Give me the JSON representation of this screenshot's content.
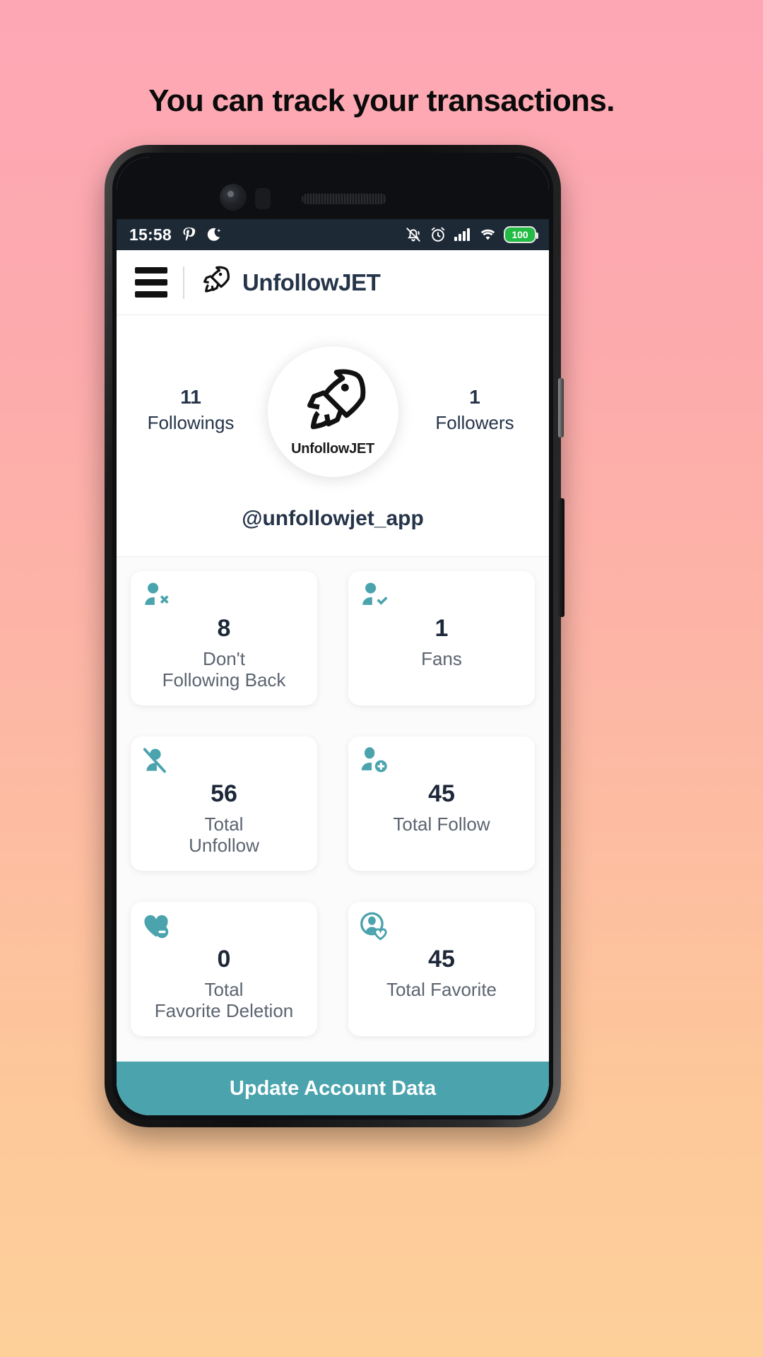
{
  "promo": {
    "headline": "You can track your transactions."
  },
  "statusbar": {
    "time": "15:58",
    "icons_left": [
      "pinterest-icon",
      "moon-star-icon"
    ],
    "icons_right": [
      "notifications-off-icon",
      "alarm-icon",
      "cellular-signal-icon",
      "wifi-icon"
    ],
    "battery_level": "100"
  },
  "appbar": {
    "menu_icon": "hamburger-menu-icon",
    "logo_icon": "rocket-icon",
    "brand": "UnfollowJET"
  },
  "profile": {
    "followings_count": "11",
    "followings_label": "Followings",
    "followers_count": "1",
    "followers_label": "Followers",
    "avatar_name": "UnfollowJET",
    "handle": "@unfollowjet_app"
  },
  "colors": {
    "accent_teal": "#4aa3ad",
    "navy": "#253449",
    "label_gray": "#5c6470",
    "status_bg": "#1e2936",
    "battery_green": "#22bb44"
  },
  "cards": [
    {
      "icon": "user-x-icon",
      "value": "8",
      "label": "Don't\nFollowing Back"
    },
    {
      "icon": "user-check-icon",
      "value": "1",
      "label": "Fans"
    },
    {
      "icon": "user-slash-icon",
      "value": "56",
      "label": "Total\nUnfollow"
    },
    {
      "icon": "user-plus-icon",
      "value": "45",
      "label": "Total Follow"
    },
    {
      "icon": "heart-minus-icon",
      "value": "0",
      "label": "Total\nFavorite Deletion"
    },
    {
      "icon": "user-heart-icon",
      "value": "45",
      "label": "Total Favorite"
    }
  ],
  "cta": {
    "label": "Update Account Data"
  }
}
